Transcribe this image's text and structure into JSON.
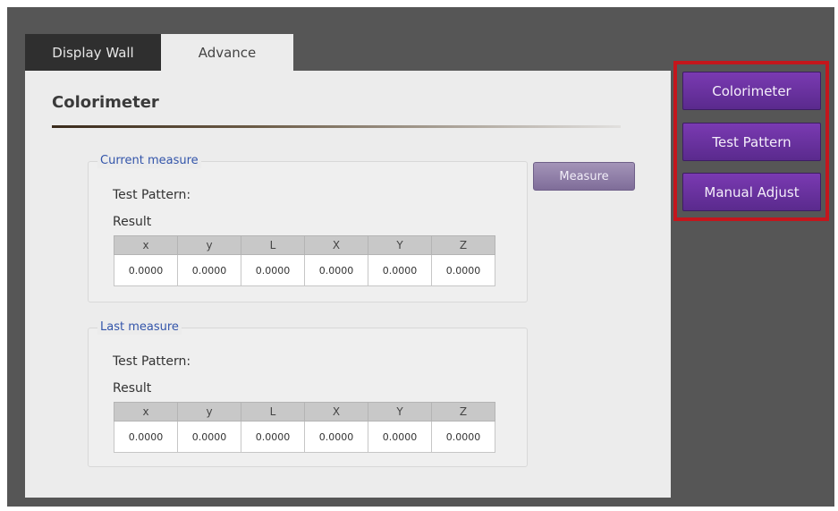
{
  "tabs": {
    "display_wall": "Display Wall",
    "advance": "Advance"
  },
  "page_title": "Colorimeter",
  "current": {
    "legend": "Current measure",
    "test_pattern_label": "Test Pattern:",
    "result_label": "Result",
    "headers": [
      "x",
      "y",
      "L",
      "X",
      "Y",
      "Z"
    ],
    "values": [
      "0.0000",
      "0.0000",
      "0.0000",
      "0.0000",
      "0.0000",
      "0.0000"
    ]
  },
  "last": {
    "legend": "Last measure",
    "test_pattern_label": "Test Pattern:",
    "result_label": "Result",
    "headers": [
      "x",
      "y",
      "L",
      "X",
      "Y",
      "Z"
    ],
    "values": [
      "0.0000",
      "0.0000",
      "0.0000",
      "0.0000",
      "0.0000",
      "0.0000"
    ]
  },
  "measure_button": "Measure",
  "side_buttons": {
    "colorimeter": "Colorimeter",
    "test_pattern": "Test Pattern",
    "manual_adjust": "Manual Adjust"
  },
  "colors": {
    "accent": "#6a34a0",
    "highlight": "#c4161c",
    "legend": "#3355aa",
    "background": "#565656"
  }
}
